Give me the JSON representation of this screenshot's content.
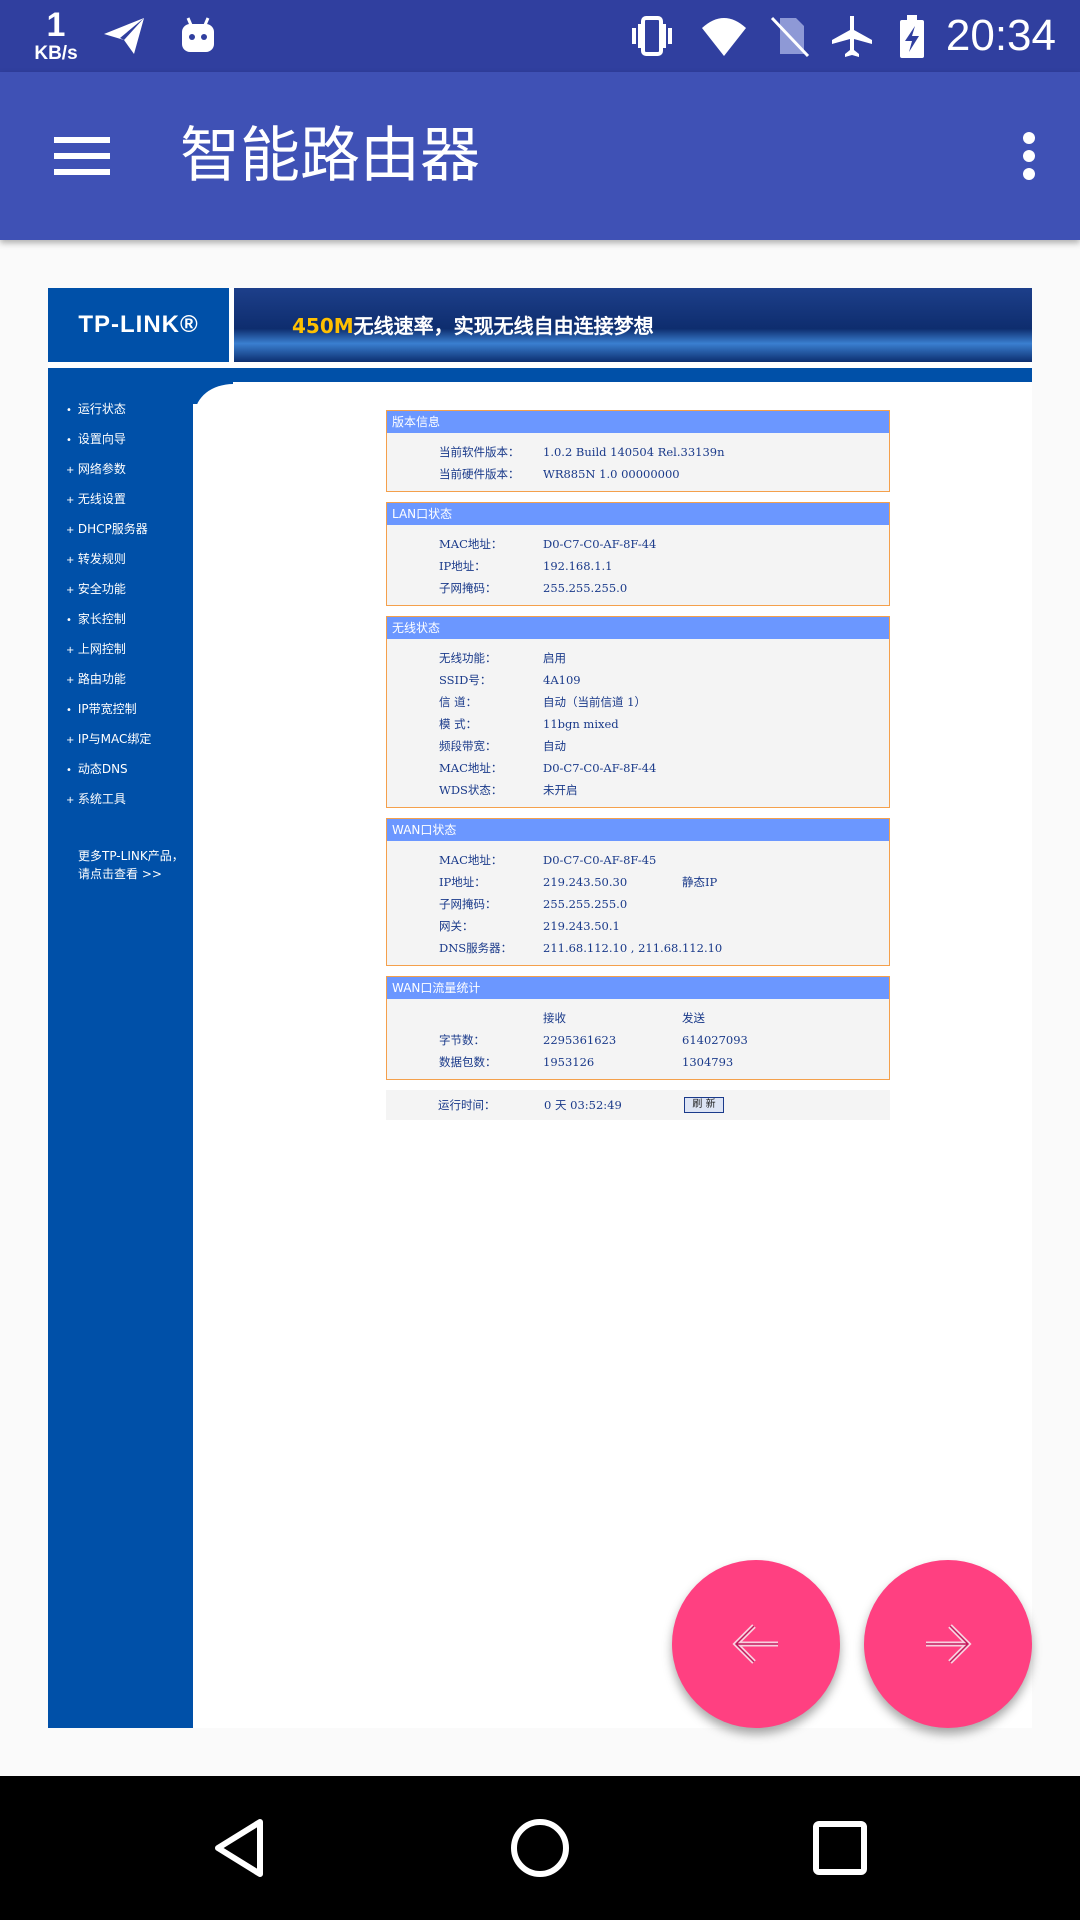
{
  "status_bar": {
    "net_speed_value": "1",
    "net_speed_unit": "KB/s",
    "time": "20:34",
    "icons": [
      "send-icon",
      "android-icon",
      "vibrate-icon",
      "wifi-icon",
      "no-sim-icon",
      "airplane-icon",
      "battery-charging-icon"
    ]
  },
  "app_bar": {
    "title": "智能路由器",
    "menu_icon": "hamburger-menu-icon",
    "more_icon": "more-vert-icon"
  },
  "router_page": {
    "logo": "TP-LINK®",
    "banner_highlight": "450M",
    "banner_text": "无线速率，实现无线自由连接梦想",
    "menu": [
      {
        "bullet": "•",
        "label": "运行状态"
      },
      {
        "bullet": "•",
        "label": "设置向导"
      },
      {
        "bullet": "+",
        "label": "网络参数"
      },
      {
        "bullet": "+",
        "label": "无线设置"
      },
      {
        "bullet": "+",
        "label": "DHCP服务器"
      },
      {
        "bullet": "+",
        "label": "转发规则"
      },
      {
        "bullet": "+",
        "label": "安全功能"
      },
      {
        "bullet": "•",
        "label": "家长控制"
      },
      {
        "bullet": "+",
        "label": "上网控制"
      },
      {
        "bullet": "+",
        "label": "路由功能"
      },
      {
        "bullet": "•",
        "label": "IP带宽控制"
      },
      {
        "bullet": "+",
        "label": "IP与MAC绑定"
      },
      {
        "bullet": "•",
        "label": "动态DNS"
      },
      {
        "bullet": "+",
        "label": "系统工具"
      }
    ],
    "more_products_line1": "更多TP-LINK产品，",
    "more_products_line2": "请点击查看 >>",
    "version": {
      "title": "版本信息",
      "rows": [
        {
          "k": "当前软件版本：",
          "v": "1.0.2 Build 140504 Rel.33139n"
        },
        {
          "k": "当前硬件版本：",
          "v": "WR885N 1.0 00000000"
        }
      ]
    },
    "lan": {
      "title": "LAN口状态",
      "rows": [
        {
          "k": "MAC地址：",
          "v": "D0-C7-C0-AF-8F-44"
        },
        {
          "k": "IP地址：",
          "v": "192.168.1.1"
        },
        {
          "k": "子网掩码：",
          "v": "255.255.255.0"
        }
      ]
    },
    "wireless": {
      "title": "无线状态",
      "rows": [
        {
          "k": "无线功能：",
          "v": "启用"
        },
        {
          "k": "SSID号：",
          "v": "4A109"
        },
        {
          "k": "信 道：",
          "v": "自动（当前信道 1）"
        },
        {
          "k": "模 式：",
          "v": "11bgn mixed"
        },
        {
          "k": "频段带宽：",
          "v": "自动"
        },
        {
          "k": "MAC地址：",
          "v": "D0-C7-C0-AF-8F-44"
        },
        {
          "k": "WDS状态：",
          "v": "未开启"
        }
      ]
    },
    "wan": {
      "title": "WAN口状态",
      "rows": [
        {
          "k": "MAC地址：",
          "v": "D0-C7-C0-AF-8F-45",
          "x": ""
        },
        {
          "k": "IP地址：",
          "v": "219.243.50.30",
          "x": "静态IP"
        },
        {
          "k": "子网掩码：",
          "v": "255.255.255.0",
          "x": ""
        },
        {
          "k": "网关：",
          "v": "219.243.50.1",
          "x": ""
        },
        {
          "k": "DNS服务器：",
          "v": "211.68.112.10 , 211.68.112.10",
          "x": ""
        }
      ]
    },
    "traffic": {
      "title": "WAN口流量统计",
      "header": {
        "k": "",
        "v": "接收",
        "x": "发送"
      },
      "rows": [
        {
          "k": "字节数：",
          "v": "2295361623",
          "x": "614027093"
        },
        {
          "k": "数据包数：",
          "v": "1953126",
          "x": "1304793"
        }
      ]
    },
    "runtime": {
      "label": "运行时间：",
      "value": "0 天 03:52:49",
      "refresh_label": "刷 新"
    }
  },
  "fab": {
    "back_icon": "arrow-left-icon",
    "forward_icon": "arrow-right-icon"
  },
  "nav_bar": {
    "back_icon": "nav-back-icon",
    "home_icon": "nav-home-icon",
    "recents_icon": "nav-recents-icon"
  },
  "colors": {
    "status_bar": "#303f9f",
    "app_bar": "#3f51b5",
    "fab": "#ff4081",
    "tp_blue": "#0050a8",
    "panel_header": "#6b97ff",
    "panel_border": "#f4a04c"
  }
}
